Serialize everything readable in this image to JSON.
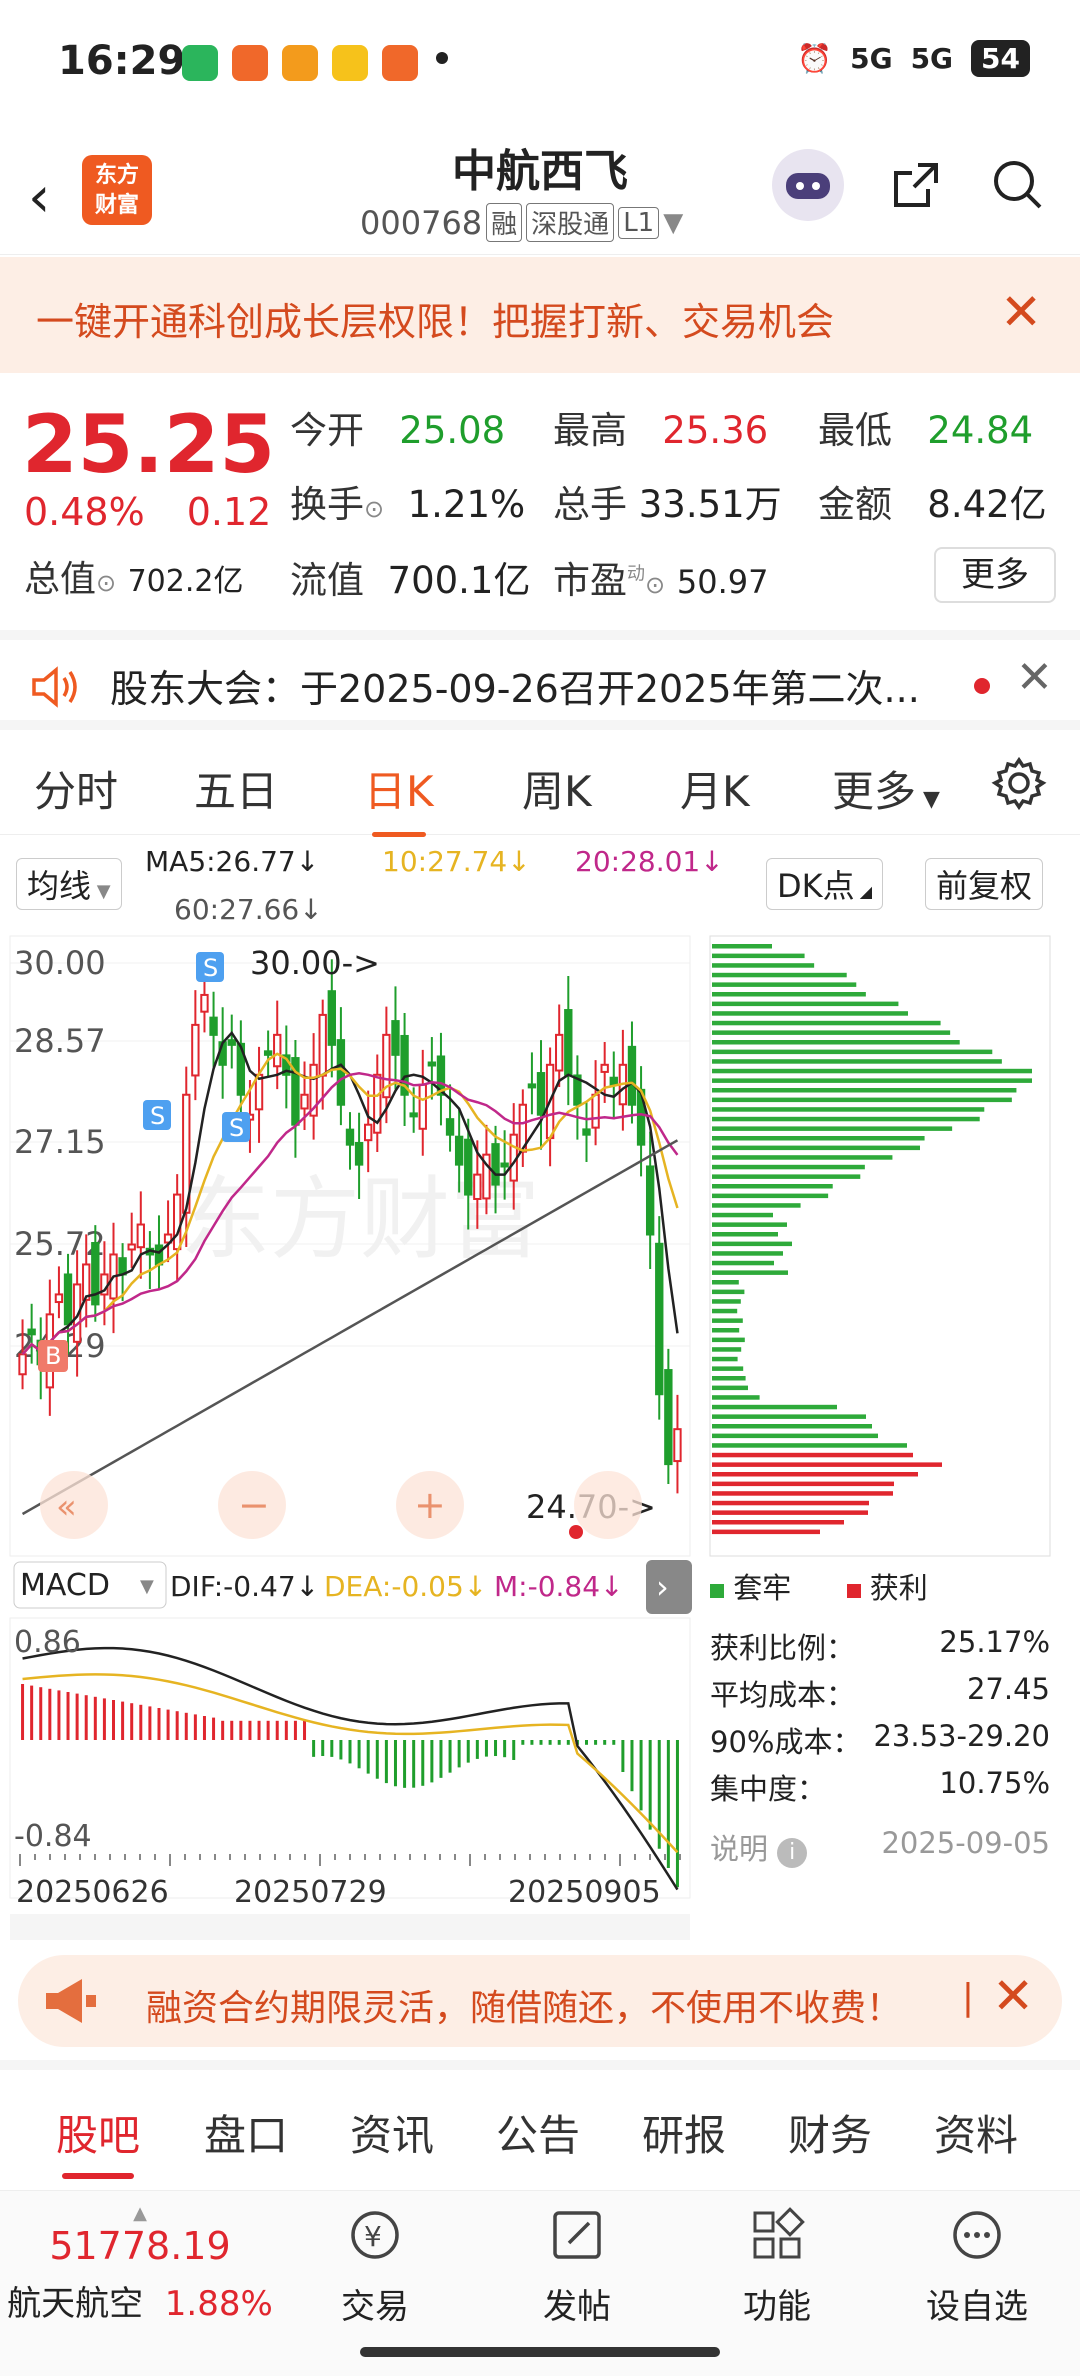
{
  "status_bar": {
    "time": "16:29",
    "signal1": "5G",
    "signal2": "5G",
    "battery": "54"
  },
  "header": {
    "stock_name": "中航西飞",
    "stock_code": "000768",
    "tags": [
      "融",
      "深股通",
      "L1"
    ],
    "logo_line1": "东方",
    "logo_line2": "财富"
  },
  "banner": {
    "text": "一键开通科创成长层权限！把握打新、交易机会"
  },
  "quote": {
    "price": "25.25",
    "change_pct": "0.48%",
    "change": "0.12",
    "open_label": "今开",
    "open": "25.08",
    "high_label": "最高",
    "high": "25.36",
    "low_label": "最低",
    "low": "24.84",
    "turnover_label": "换手",
    "turnover": "1.21%",
    "volume_label": "总手",
    "volume": "33.51万",
    "amount_label": "金额",
    "amount": "8.42亿",
    "mcap_label": "总值",
    "mcap": "702.2亿",
    "float_label": "流值",
    "float": "700.1亿",
    "pe_label": "市盈",
    "pe_sup": "动",
    "pe": "50.97",
    "more": "更多"
  },
  "notice": {
    "text": "股东大会：于2025-09-26召开2025年第二次..."
  },
  "period_tabs": [
    "分时",
    "五日",
    "日K",
    "周K",
    "月K",
    "更多"
  ],
  "active_period": "日K",
  "indicator_bar": {
    "ma_type": "均线",
    "ma5": "MA5:26.77↓",
    "ma10": "10:27.74↓",
    "ma20": "20:28.01↓",
    "ma60": "60:27.66↓",
    "dk": "DK点",
    "adjust": "前复权"
  },
  "kline_labels": {
    "y_ticks": [
      "30.00",
      "28.57",
      "27.15",
      "25.72",
      "24.29"
    ],
    "high_mark": "30.00->",
    "low_mark": "24.70->",
    "watermark": "东方财富"
  },
  "macd_bar": {
    "name": "MACD",
    "dif": "DIF:-0.47↓",
    "dea": "DEA:-0.05↓",
    "m": "M:-0.84↓"
  },
  "macd_labels": {
    "top": "0.86",
    "bottom": "-0.84"
  },
  "x_dates": [
    "20250626",
    "20250729",
    "20250905"
  ],
  "chip": {
    "legend_trapped": "套牢",
    "legend_profit": "获利",
    "stats": [
      {
        "k": "获利比例：",
        "v": "25.17%"
      },
      {
        "k": "平均成本：",
        "v": "27.45"
      },
      {
        "k": "90%成本：",
        "v": "23.53-29.20"
      },
      {
        "k": "集中度：",
        "v": "10.75%"
      }
    ],
    "note": "说明",
    "date": "2025-09-05"
  },
  "colors": {
    "up": "#e0262e",
    "down": "#1f9e2c",
    "ma5": "#222222",
    "ma10": "#e6b422",
    "ma20": "#c0288a",
    "ma60": "#555555",
    "accent": "#ef5a21"
  },
  "promo": {
    "text": "融资合约期限灵活，随借随还，不使用不收费！"
  },
  "bottom_tabs": [
    "股吧",
    "盘口",
    "资讯",
    "公告",
    "研报",
    "财务",
    "资料"
  ],
  "active_bottom_tab": "股吧",
  "bottom_bar": {
    "index_value": "51778.19",
    "index_name": "航天航空",
    "index_change": "1.88%",
    "items": [
      "交易",
      "发帖",
      "功能",
      "设自选"
    ]
  }
}
